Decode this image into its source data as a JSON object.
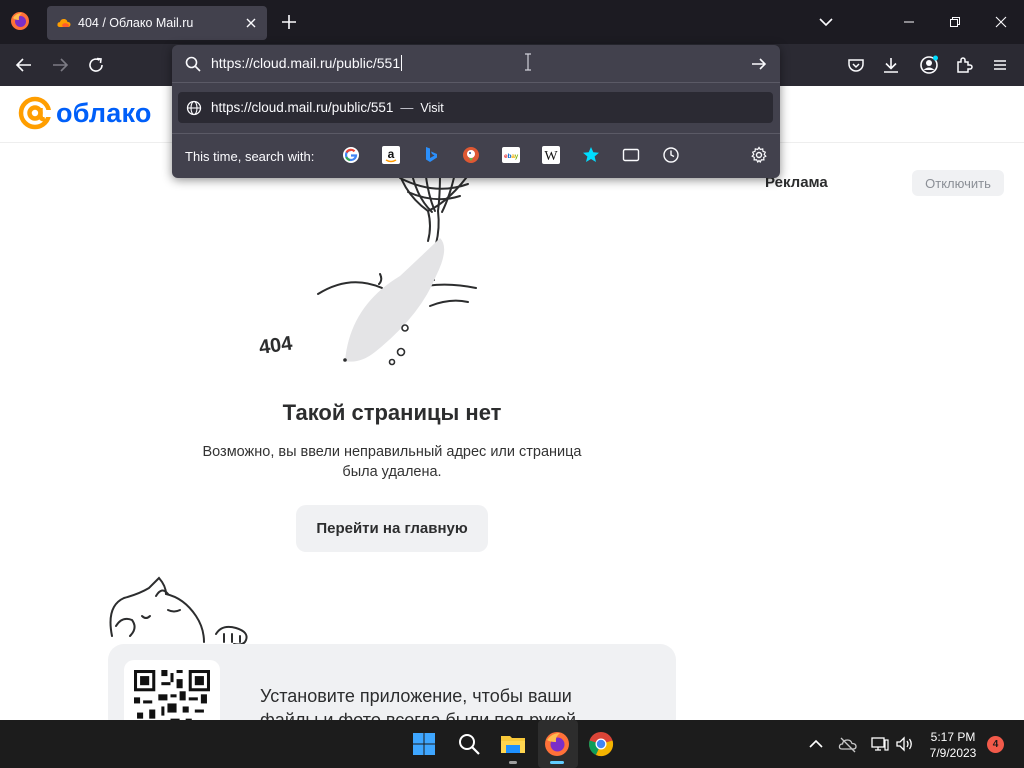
{
  "browser": {
    "tab": {
      "title": "404 / Облако Mail.ru"
    },
    "url_bar": {
      "value": "https://cloud.mail.ru/public/551",
      "suggestion_url": "https://cloud.mail.ru/public/551",
      "suggestion_dash": "—",
      "suggestion_action": "Visit",
      "search_with_label": "This time, search with:",
      "engines": [
        "google",
        "amazon",
        "bing",
        "duckduckgo",
        "ebay",
        "wikipedia",
        "bookmarks",
        "tabs",
        "history"
      ]
    }
  },
  "page": {
    "logo_text": "облако",
    "ad_label": "Реклама",
    "ad_disable": "Отключить",
    "illustration_label": "404",
    "title": "Такой страницы нет",
    "description": "Возможно, вы ввели неправильный адрес или страница была удалена.",
    "home_button": "Перейти на главную",
    "promo_text": "Установите приложение, чтобы ваши файлы и фото всегда были под рукой"
  },
  "taskbar": {
    "time": "5:17 PM",
    "date": "7/9/2023",
    "notification_count": "4"
  },
  "colors": {
    "cloud_blue": "#005ff9",
    "cloud_orange": "#ff9e00",
    "firefox_dark": "#1c1b22",
    "firefox_toolbar": "#2b2a33",
    "urlbar_panel": "#42414d"
  }
}
